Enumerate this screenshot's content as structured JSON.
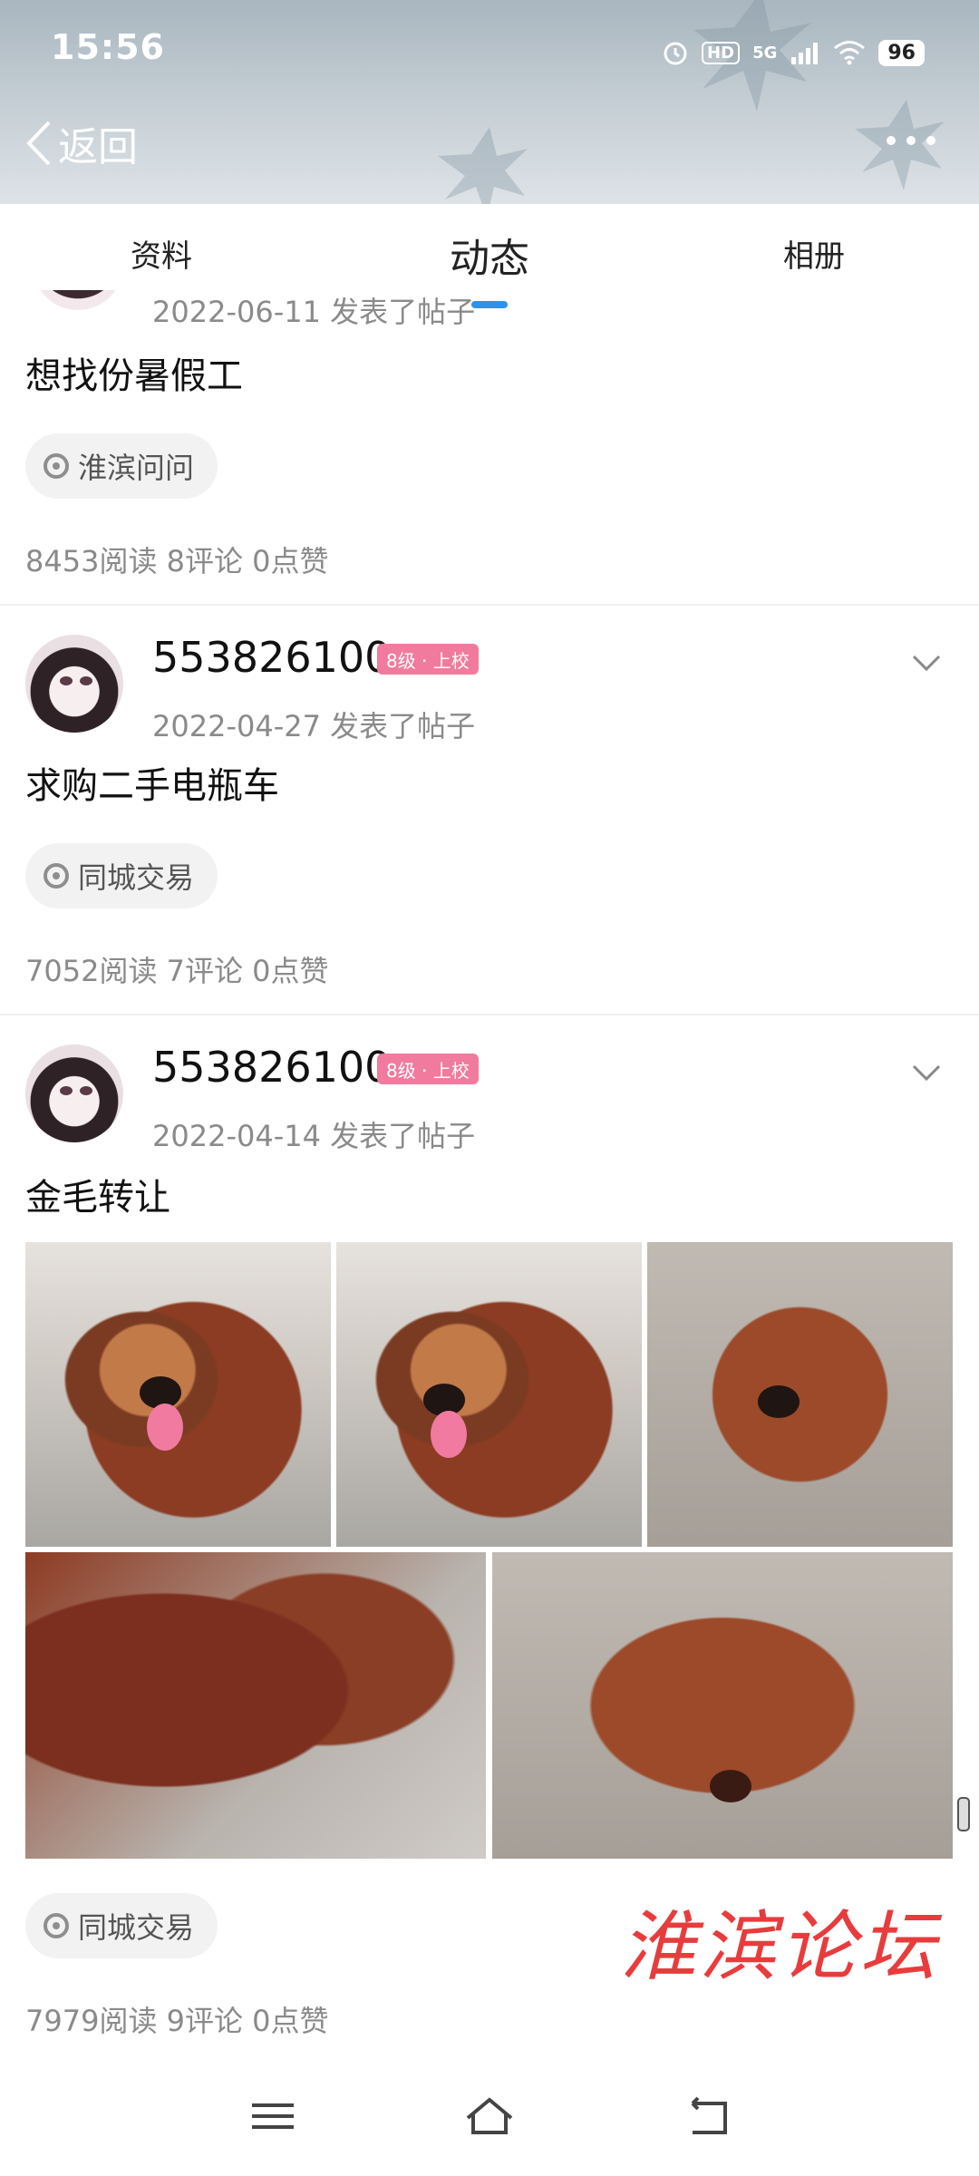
{
  "status_bar": {
    "time": "15:56",
    "battery": "96",
    "network": "5G",
    "hd": "HD"
  },
  "header": {
    "back_label": "返回"
  },
  "tabs": [
    {
      "label": "资料",
      "active": false
    },
    {
      "label": "动态",
      "active": true
    },
    {
      "label": "相册",
      "active": false
    }
  ],
  "posts": [
    {
      "date_line": "2022-06-11 发表了帖子",
      "title": "想找份暑假工",
      "tag": "淮滨问问",
      "stats": "8453阅读 8评论 0点赞"
    },
    {
      "username": "553826100",
      "badge": "8级 · 上校",
      "date_line": "2022-04-27 发表了帖子",
      "title": "求购二手电瓶车",
      "tag": "同城交易",
      "stats": "7052阅读 7评论 0点赞"
    },
    {
      "username": "553826100",
      "badge": "8级 · 上校",
      "date_line": "2022-04-14 发表了帖子",
      "title": "金毛转让",
      "tag": "同城交易",
      "stats": "7979阅读 9评论 0点赞",
      "image_count": 5
    }
  ],
  "watermark": "淮滨论坛",
  "colors": {
    "accent": "#2e93e8",
    "badge": "#f07b9f",
    "watermark": "#e83c3c"
  },
  "icons": [
    "back-icon",
    "more-icon",
    "chevron-down-icon",
    "tag-icon",
    "menu-icon",
    "home-icon",
    "return-icon",
    "alarm-icon",
    "wifi-icon",
    "signal-icon"
  ]
}
